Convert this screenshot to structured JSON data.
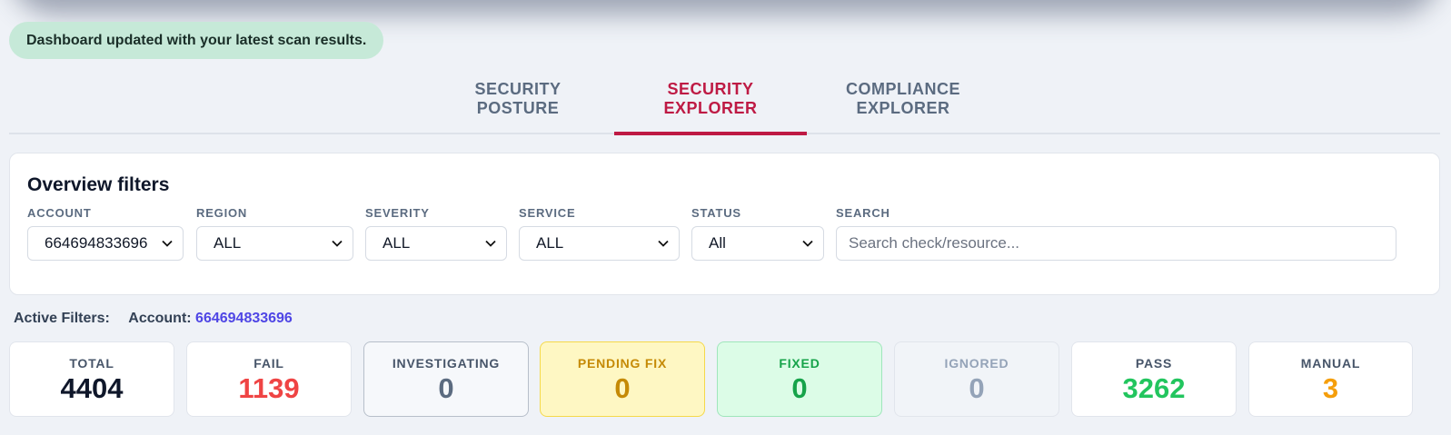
{
  "toast": {
    "message": "Dashboard updated with your latest scan results."
  },
  "tabs": [
    {
      "label": "SECURITY POSTURE",
      "active": false
    },
    {
      "label": "SECURITY EXPLORER",
      "active": true
    },
    {
      "label": "COMPLIANCE EXPLORER",
      "active": false
    }
  ],
  "filters": {
    "title": "Overview filters",
    "account": {
      "label": "ACCOUNT",
      "value": "664694833696"
    },
    "region": {
      "label": "REGION",
      "value": "ALL"
    },
    "severity": {
      "label": "SEVERITY",
      "value": "ALL"
    },
    "service": {
      "label": "SERVICE",
      "value": "ALL"
    },
    "status": {
      "label": "STATUS",
      "value": "All"
    },
    "search": {
      "label": "SEARCH",
      "placeholder": "Search check/resource..."
    }
  },
  "active_filters": {
    "label": "Active Filters:",
    "account_label": "Account:",
    "account_value": "664694833696"
  },
  "stats": [
    {
      "label": "TOTAL",
      "value": "4404"
    },
    {
      "label": "FAIL",
      "value": "1139"
    },
    {
      "label": "INVESTIGATING",
      "value": "0"
    },
    {
      "label": "PENDING FIX",
      "value": "0"
    },
    {
      "label": "FIXED",
      "value": "0"
    },
    {
      "label": "IGNORED",
      "value": "0"
    },
    {
      "label": "PASS",
      "value": "3262"
    },
    {
      "label": "MANUAL",
      "value": "3"
    }
  ],
  "colors": {
    "accent": "#be1a44",
    "link": "#4f46e5",
    "fail": "#ef4444",
    "pass": "#22c55e",
    "manual": "#f59e0b"
  }
}
